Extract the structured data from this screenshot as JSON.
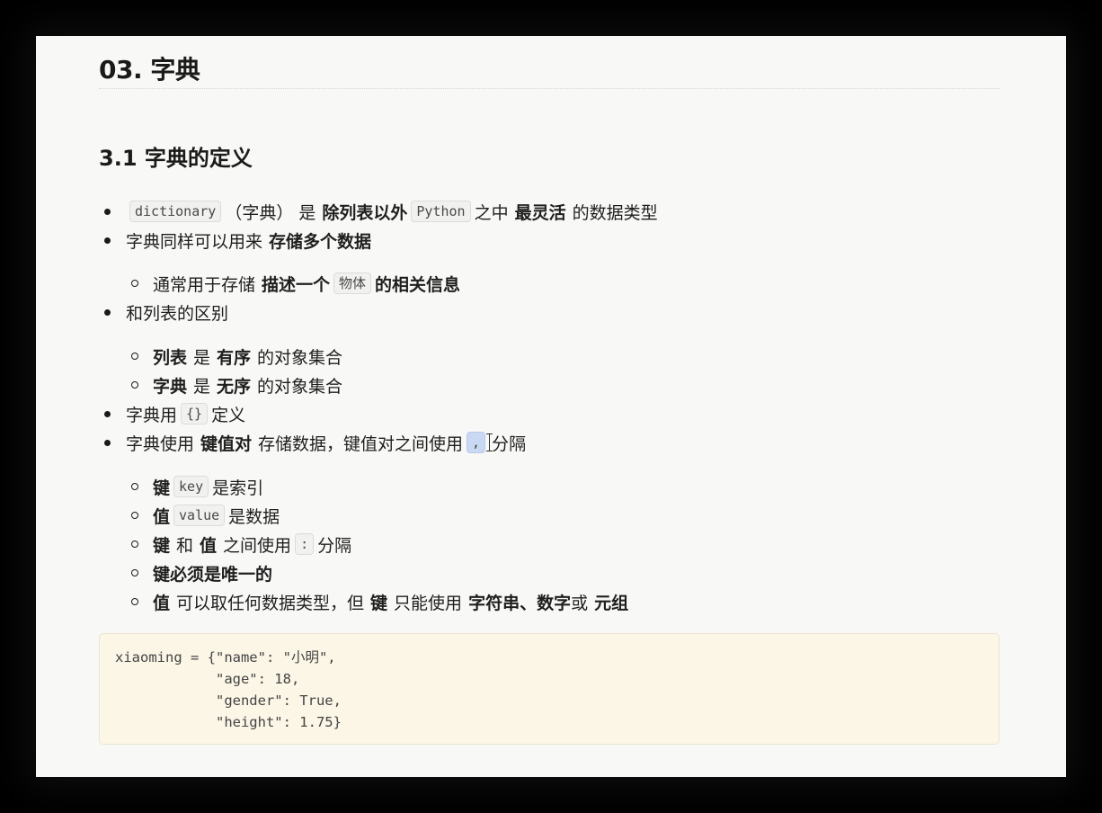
{
  "heading1": "03. 字典",
  "heading2": "3.1 字典的定义",
  "items": {
    "i1": {
      "code1": "dictionary",
      "t1": "（字典） 是",
      "b1": "除列表以外",
      "code2": "Python",
      "t2": "之中",
      "b2": "最灵活",
      "t3": "的数据类型"
    },
    "i2": {
      "t1": "字典同样可以用来",
      "b1": "存储多个数据"
    },
    "i2a": {
      "t1": "通常用于存储",
      "b1": "描述一个",
      "code1": "物体",
      "b2": "的相关信息"
    },
    "i3": {
      "t1": "和列表的区别"
    },
    "i3a": {
      "b1": "列表",
      "t1": "是",
      "b2": "有序",
      "t2": "的对象集合"
    },
    "i3b": {
      "b1": "字典",
      "t1": "是",
      "b2": "无序",
      "t2": "的对象集合"
    },
    "i4": {
      "t1": "字典用",
      "code1": "{}",
      "t2": "定义"
    },
    "i5": {
      "t1": "字典使用",
      "b1": "键值对",
      "t2": "存储数据，键值对之间使用",
      "code1": ",",
      "t3": "分隔"
    },
    "i5a": {
      "b1": "键",
      "code1": "key",
      "t1": "是索引"
    },
    "i5b": {
      "b1": "值",
      "code1": "value",
      "t1": "是数据"
    },
    "i5c": {
      "b1": "键",
      "t1": "和",
      "b2": "值",
      "t2": "之间使用",
      "code1": ":",
      "t3": "分隔"
    },
    "i5d": {
      "b1": "键必须是唯一的"
    },
    "i5e": {
      "b1": "值",
      "t1": "可以取任何数据类型，但",
      "b2": "键",
      "t2": "只能使用",
      "b3": "字符串、数字",
      "t3": "或",
      "b4": "元组"
    }
  },
  "code_block": "xiaoming = {\"name\": \"小明\",\n            \"age\": 18,\n            \"gender\": True,\n            \"height\": 1.75}"
}
